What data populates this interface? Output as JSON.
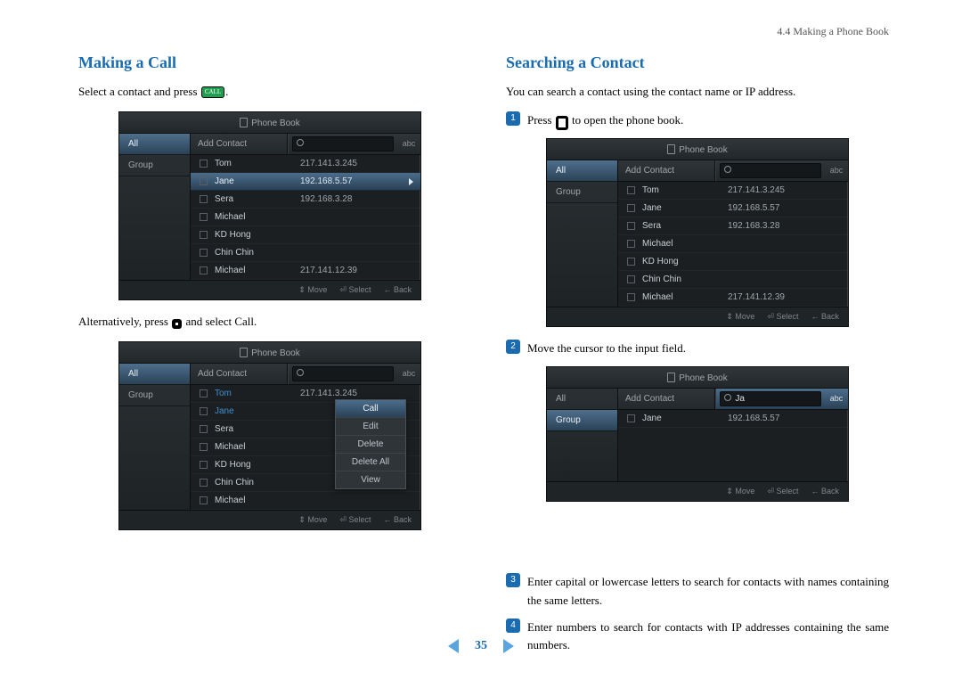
{
  "header": {
    "breadcrumb": "4.4 Making a Phone Book"
  },
  "left": {
    "title": "Making a Call",
    "line1a": "Select a contact and press ",
    "line1b": ".",
    "call_btn_label": "CALL",
    "line2a": "Alternatively, press ",
    "line2b": " and select Call."
  },
  "right": {
    "title": "Searching a Contact",
    "intro": "You can search a contact using the contact name or IP address.",
    "step1a": "Press ",
    "step1b": " to open the phone book.",
    "step2": "Move the cursor to the input field.",
    "step3": "Enter capital or lowercase letters to search for contacts with names containing the same letters.",
    "step4": "Enter numbers to search for contacts with IP addresses containing the same numbers."
  },
  "pb_common": {
    "title": "Phone Book",
    "side_all": "All",
    "side_group": "Group",
    "add_contact": "Add Contact",
    "abc": "abc",
    "footer_move": "⇕ Move",
    "footer_select": "⏎ Select",
    "footer_back": "← Back"
  },
  "pb1": {
    "selected_side": "All",
    "rows": [
      {
        "name": "Tom",
        "ip": "217.141.3.245",
        "sel": false,
        "blue": false
      },
      {
        "name": "Jane",
        "ip": "192.168.5.57",
        "sel": true,
        "blue": false
      },
      {
        "name": "Sera",
        "ip": "192.168.3.28",
        "sel": false,
        "blue": false
      },
      {
        "name": "Michael",
        "ip": "",
        "sel": false,
        "blue": false
      },
      {
        "name": "KD Hong",
        "ip": "",
        "sel": false,
        "blue": false
      },
      {
        "name": "Chin Chin",
        "ip": "",
        "sel": false,
        "blue": false
      },
      {
        "name": "Michael",
        "ip": "217.141.12.39",
        "sel": false,
        "blue": false
      }
    ]
  },
  "pb2": {
    "selected_side": "All",
    "rows": [
      {
        "name": "Tom",
        "ip": "217.141.3.245",
        "sel": false,
        "blue": true
      },
      {
        "name": "Jane",
        "ip": "",
        "sel": false,
        "blue": true
      },
      {
        "name": "Sera",
        "ip": "",
        "sel": false,
        "blue": false
      },
      {
        "name": "Michael",
        "ip": "",
        "sel": false,
        "blue": false
      },
      {
        "name": "KD Hong",
        "ip": "",
        "sel": false,
        "blue": false
      },
      {
        "name": "Chin Chin",
        "ip": "",
        "sel": false,
        "blue": false
      },
      {
        "name": "Michael",
        "ip": "",
        "sel": false,
        "blue": false
      }
    ],
    "menu": [
      "Call",
      "Edit",
      "Delete",
      "Delete All",
      "View"
    ],
    "menu_sel": "Call"
  },
  "pb3": {
    "selected_side": "All",
    "rows": [
      {
        "name": "Tom",
        "ip": "217.141.3.245",
        "sel": false,
        "blue": false
      },
      {
        "name": "Jane",
        "ip": "192.168.5.57",
        "sel": false,
        "blue": false
      },
      {
        "name": "Sera",
        "ip": "192.168.3.28",
        "sel": false,
        "blue": false
      },
      {
        "name": "Michael",
        "ip": "",
        "sel": false,
        "blue": false
      },
      {
        "name": "KD Hong",
        "ip": "",
        "sel": false,
        "blue": false
      },
      {
        "name": "Chin Chin",
        "ip": "",
        "sel": false,
        "blue": false
      },
      {
        "name": "Michael",
        "ip": "217.141.12.39",
        "sel": false,
        "blue": false
      }
    ]
  },
  "pb4": {
    "selected_side": "Group",
    "search_text": "Ja",
    "rows": [
      {
        "name": "Jane",
        "ip": "192.168.5.57",
        "sel": false,
        "blue": false
      }
    ]
  },
  "nav": {
    "page": "35"
  }
}
